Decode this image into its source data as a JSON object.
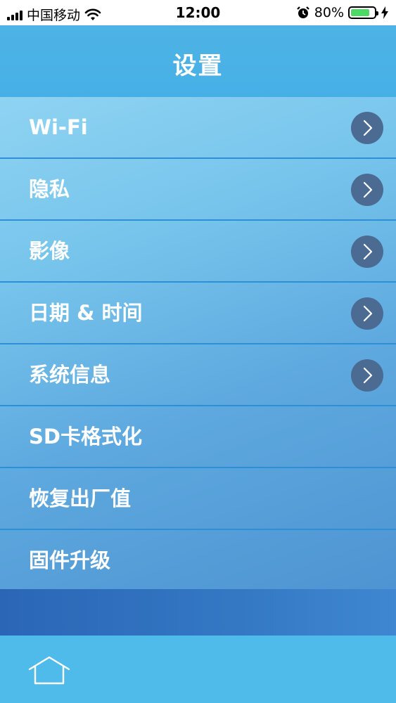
{
  "status": {
    "carrier": "中国移动",
    "time": "12:00",
    "battery": "80%",
    "battery_level": 0.8,
    "icons": [
      "signal-icon",
      "wifi-icon",
      "alarm-icon",
      "battery-icon",
      "charging-icon"
    ]
  },
  "header": {
    "title": "设置"
  },
  "menu": {
    "items": [
      {
        "label": "Wi-Fi",
        "chevron": true
      },
      {
        "label": "隐私",
        "chevron": true
      },
      {
        "label": "影像",
        "chevron": true
      },
      {
        "label": "日期 & 时间",
        "chevron": true
      },
      {
        "label": "系统信息",
        "chevron": true
      },
      {
        "label": "SD卡格式化",
        "chevron": false
      },
      {
        "label": "恢复出厂值",
        "chevron": false
      },
      {
        "label": "固件升级",
        "chevron": false
      }
    ]
  },
  "tabbar": {
    "icon": "home-icon"
  },
  "colors": {
    "accent": "#4fbbea",
    "chevron_bg": "#4c6b93",
    "band": "#2b66b6"
  }
}
